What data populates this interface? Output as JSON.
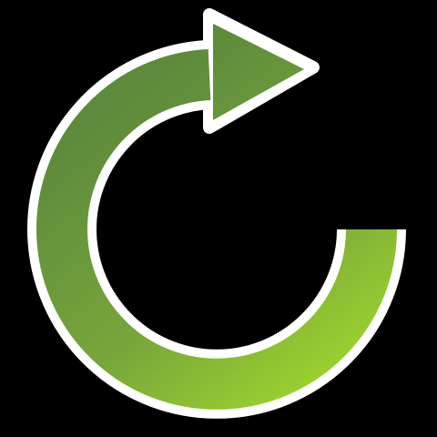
{
  "icon": {
    "name": "refresh-icon",
    "colors": {
      "background": "#000000",
      "outline": "#ffffff",
      "gradient_dark": "#5e8a3c",
      "gradient_mid": "#79a63b",
      "gradient_light": "#9fd62d"
    }
  }
}
